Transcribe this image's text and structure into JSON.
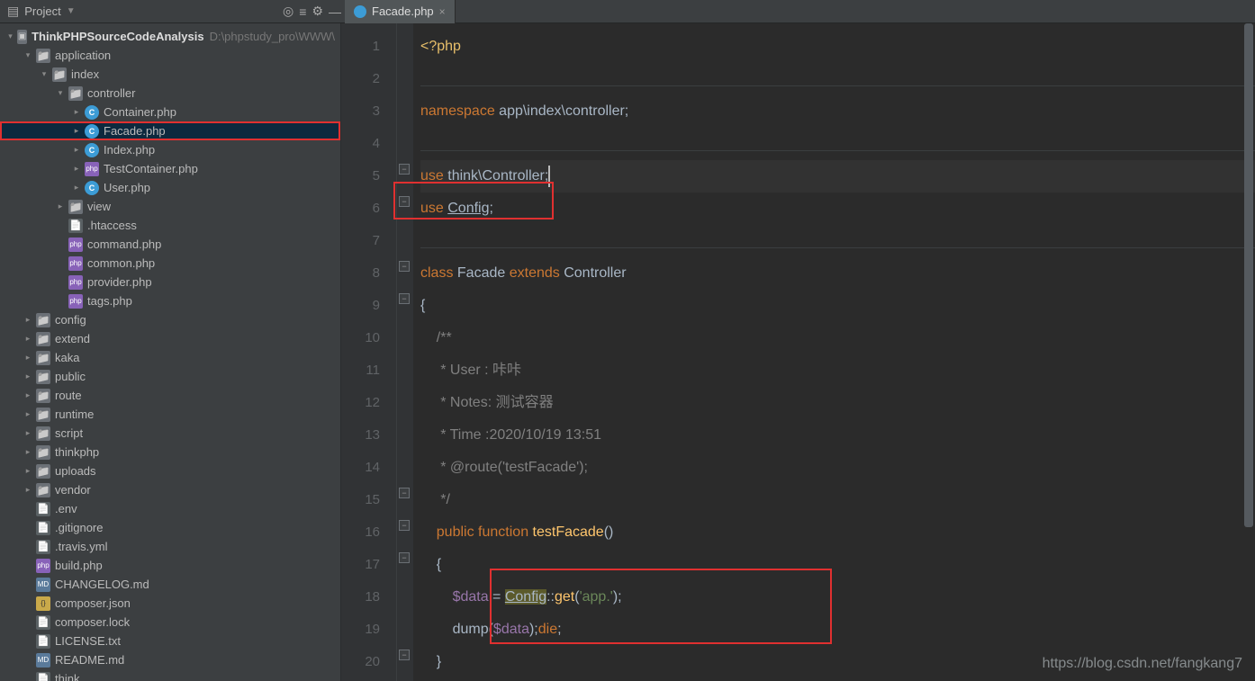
{
  "toolbar": {
    "project_label": "Project"
  },
  "tab": {
    "name": "Facade.php"
  },
  "tree": [
    {
      "d": 0,
      "a": "d",
      "i": "root",
      "name": "ThinkPHPSourceCodeAnalysis",
      "bold": true,
      "path": "D:\\phpstudy_pro\\WWW\\"
    },
    {
      "d": 1,
      "a": "d",
      "i": "folder",
      "name": "application"
    },
    {
      "d": 2,
      "a": "d",
      "i": "folder",
      "name": "index"
    },
    {
      "d": 3,
      "a": "d",
      "i": "folder",
      "name": "controller"
    },
    {
      "d": 4,
      "a": "r",
      "i": "php",
      "name": "Container.php"
    },
    {
      "d": 4,
      "a": "r",
      "i": "php",
      "name": "Facade.php",
      "sel": true,
      "hl": true
    },
    {
      "d": 4,
      "a": "r",
      "i": "php",
      "name": "Index.php"
    },
    {
      "d": 4,
      "a": "r",
      "i": "phpf",
      "name": "TestContainer.php"
    },
    {
      "d": 4,
      "a": "r",
      "i": "php",
      "name": "User.php"
    },
    {
      "d": 3,
      "a": "r",
      "i": "folder",
      "name": "view"
    },
    {
      "d": 3,
      "a": "n",
      "i": "file",
      "name": ".htaccess"
    },
    {
      "d": 3,
      "a": "n",
      "i": "phpf",
      "name": "command.php"
    },
    {
      "d": 3,
      "a": "n",
      "i": "phpf",
      "name": "common.php"
    },
    {
      "d": 3,
      "a": "n",
      "i": "phpf",
      "name": "provider.php"
    },
    {
      "d": 3,
      "a": "n",
      "i": "phpf",
      "name": "tags.php"
    },
    {
      "d": 1,
      "a": "r",
      "i": "folder",
      "name": "config"
    },
    {
      "d": 1,
      "a": "r",
      "i": "folder",
      "name": "extend"
    },
    {
      "d": 1,
      "a": "r",
      "i": "folder",
      "name": "kaka"
    },
    {
      "d": 1,
      "a": "r",
      "i": "folder",
      "name": "public"
    },
    {
      "d": 1,
      "a": "r",
      "i": "folder",
      "name": "route"
    },
    {
      "d": 1,
      "a": "r",
      "i": "folder",
      "name": "runtime"
    },
    {
      "d": 1,
      "a": "r",
      "i": "folder",
      "name": "script"
    },
    {
      "d": 1,
      "a": "r",
      "i": "folder",
      "name": "thinkphp"
    },
    {
      "d": 1,
      "a": "r",
      "i": "folder",
      "name": "uploads"
    },
    {
      "d": 1,
      "a": "r",
      "i": "folder",
      "name": "vendor"
    },
    {
      "d": 1,
      "a": "n",
      "i": "file",
      "name": ".env"
    },
    {
      "d": 1,
      "a": "n",
      "i": "file",
      "name": ".gitignore"
    },
    {
      "d": 1,
      "a": "n",
      "i": "file",
      "name": ".travis.yml"
    },
    {
      "d": 1,
      "a": "n",
      "i": "phpf",
      "name": "build.php"
    },
    {
      "d": 1,
      "a": "n",
      "i": "md",
      "name": "CHANGELOG.md"
    },
    {
      "d": 1,
      "a": "n",
      "i": "json",
      "name": "composer.json"
    },
    {
      "d": 1,
      "a": "n",
      "i": "file",
      "name": "composer.lock"
    },
    {
      "d": 1,
      "a": "n",
      "i": "file",
      "name": "LICENSE.txt"
    },
    {
      "d": 1,
      "a": "n",
      "i": "md",
      "name": "README.md"
    },
    {
      "d": 1,
      "a": "n",
      "i": "file",
      "name": "think"
    }
  ],
  "code": {
    "l1_open": "<?php",
    "l3_ns": "namespace",
    "l3_path": " app\\index\\controller;",
    "l5_use": "use",
    "l5_a": " think\\Controller;",
    "l6_use": "use",
    "l6_cfg": "Config",
    "l6_sc": ";",
    "l8_class": "class",
    "l8_name": " Facade ",
    "l8_ext": "extends",
    "l8_ctrl": " Controller",
    "l9": "{",
    "l10": "/**",
    "l11": " * User : 咔咔",
    "l12": " * Notes: 测试容器",
    "l13": " * Time :2020/10/19 13:51",
    "l14": " * @route('testFacade');",
    "l15": " */",
    "l16_pub": "public",
    "l16_func": "function",
    "l16_name": "testFacade",
    "l16_p": "()",
    "l17": "{",
    "l18_v": "$data",
    "l18_eq": " = ",
    "l18_cfg": "Config",
    "l18_cc": "::",
    "l18_get": "get",
    "l18_paren": "(",
    "l18_str": "'app.'",
    "l18_end": ");",
    "l19_dump": "dump",
    "l19_po": "(",
    "l19_v": "$data",
    "l19_pc": ");",
    "l19_die": "die",
    "l19_sc": ";",
    "l20": "}"
  },
  "watermark": "https://blog.csdn.net/fangkang7"
}
